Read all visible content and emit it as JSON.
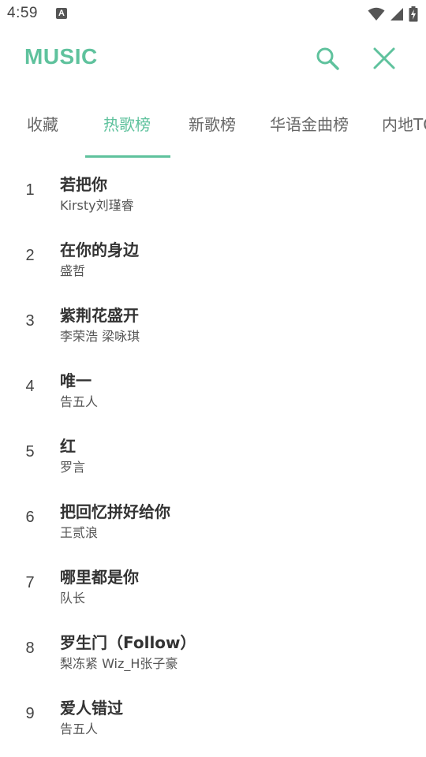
{
  "status_bar": {
    "time": "4:59",
    "notification_icon": "a-notification-icon",
    "icons": [
      "wifi-icon",
      "signal-icon",
      "battery-charging-icon"
    ]
  },
  "app_bar": {
    "title": "MUSIC",
    "accent_color": "#5fc29d",
    "actions": [
      "search-icon",
      "close-icon"
    ]
  },
  "tabs": {
    "items": [
      {
        "label": "收藏",
        "active": false
      },
      {
        "label": "热歌榜",
        "active": true
      },
      {
        "label": "新歌榜",
        "active": false
      },
      {
        "label": "华语金曲榜",
        "active": false
      },
      {
        "label": "内地TOP",
        "active": false
      }
    ]
  },
  "songs": [
    {
      "rank": "1",
      "title": "若把你",
      "artist": "Kirsty刘瑾睿"
    },
    {
      "rank": "2",
      "title": "在你的身边",
      "artist": "盛哲"
    },
    {
      "rank": "3",
      "title": "紫荆花盛开",
      "artist": "李荣浩  梁咏琪"
    },
    {
      "rank": "4",
      "title": "唯一",
      "artist": "告五人"
    },
    {
      "rank": "5",
      "title": "红",
      "artist": "罗言"
    },
    {
      "rank": "6",
      "title": "把回忆拼好给你",
      "artist": "王贰浪"
    },
    {
      "rank": "7",
      "title": "哪里都是你",
      "artist": "队长"
    },
    {
      "rank": "8",
      "title": "罗生门（Follow）",
      "artist": "梨冻紧  Wiz_H张子豪"
    },
    {
      "rank": "9",
      "title": "爱人错过",
      "artist": "告五人"
    }
  ]
}
